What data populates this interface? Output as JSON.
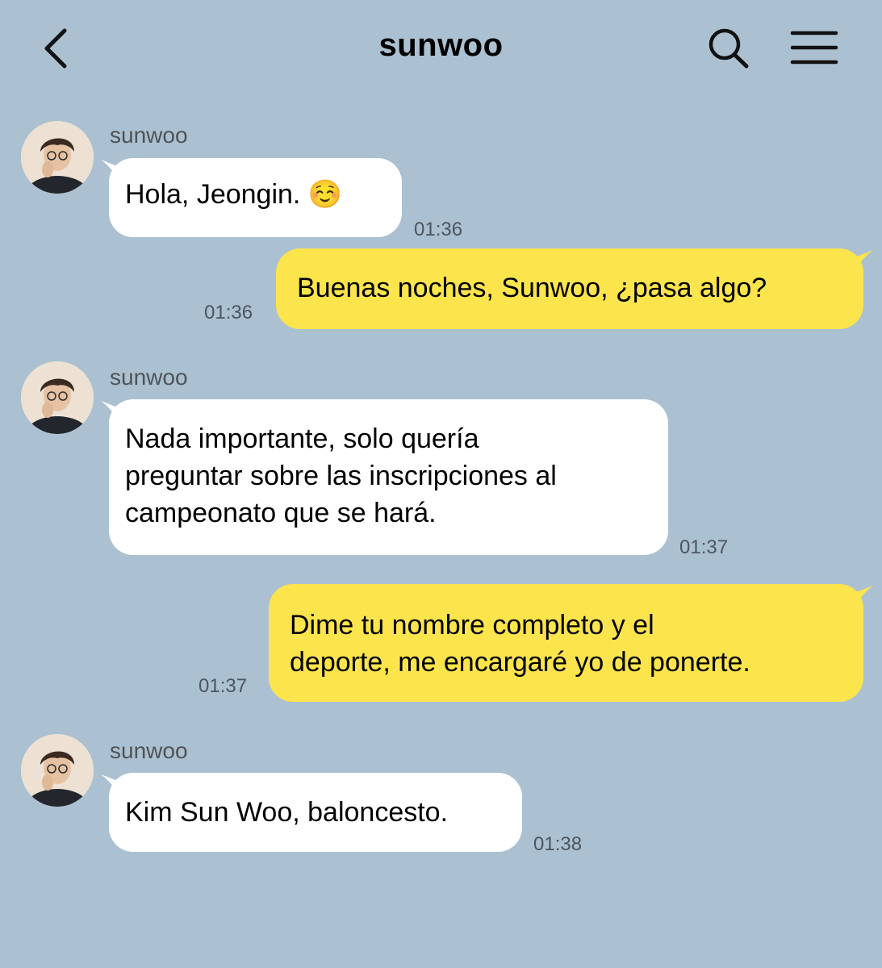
{
  "header": {
    "title": "sunwoo",
    "back_icon": "chevron-left-icon",
    "search_icon": "search-icon",
    "menu_icon": "hamburger-menu-icon"
  },
  "colors": {
    "background": "#abc1d1",
    "incoming_bubble": "#ffffff",
    "outgoing_bubble": "#fbe44c"
  },
  "messages": [
    {
      "direction": "incoming",
      "sender": "sunwoo",
      "lines": [
        "Hola, Jeongin. ☺️"
      ],
      "time": "01:36"
    },
    {
      "direction": "outgoing",
      "lines": [
        "Buenas noches, Sunwoo, ¿pasa algo?"
      ],
      "time": "01:36"
    },
    {
      "direction": "incoming",
      "sender": "sunwoo",
      "lines": [
        "Nada importante, solo quería",
        "preguntar sobre las inscripciones al",
        "campeonato que se hará."
      ],
      "time": "01:37"
    },
    {
      "direction": "outgoing",
      "lines": [
        "Dime tu nombre completo y el",
        "deporte, me encargaré yo de ponerte."
      ],
      "time": "01:37"
    },
    {
      "direction": "incoming",
      "sender": "sunwoo",
      "lines": [
        "Kim Sun Woo, baloncesto."
      ],
      "time": "01:38"
    }
  ]
}
